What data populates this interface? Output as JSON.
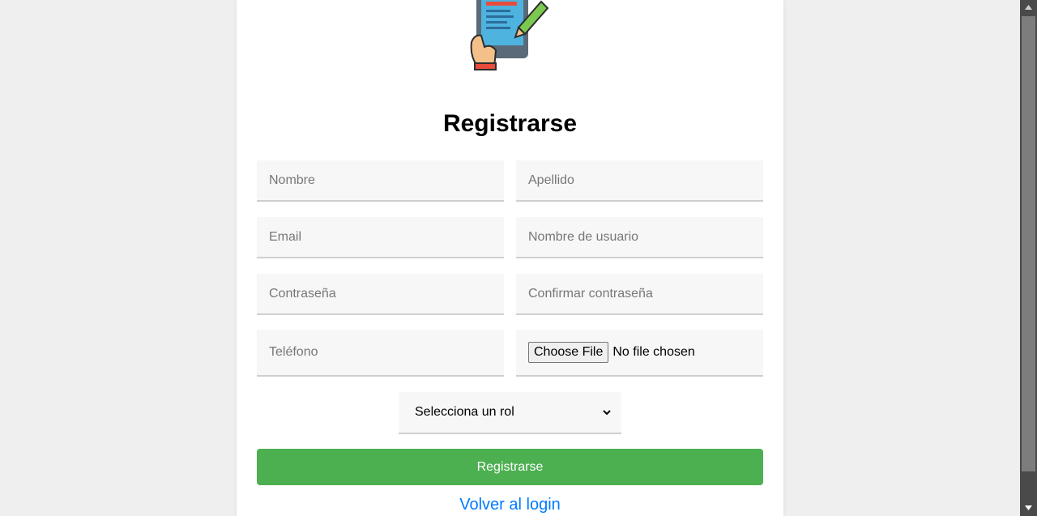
{
  "form": {
    "title": "Registrarse",
    "fields": {
      "nombre_placeholder": "Nombre",
      "apellido_placeholder": "Apellido",
      "email_placeholder": "Email",
      "username_placeholder": "Nombre de usuario",
      "password_placeholder": "Contraseña",
      "confirm_password_placeholder": "Confirmar contraseña",
      "telefono_placeholder": "Teléfono"
    },
    "file": {
      "button_label": "Choose File",
      "status": "No file chosen"
    },
    "role_select": {
      "selected": "Selecciona un rol"
    },
    "submit_label": "Registrarse",
    "back_link": "Volver al login"
  },
  "colors": {
    "submit_bg": "#4caf50",
    "link": "#007bff",
    "page_bg": "#efefef"
  },
  "icons": {
    "logo": "phone-form-icon",
    "select_chevron": "chevron-down-icon",
    "scroll_up": "arrow-up-icon",
    "scroll_down": "arrow-down-icon"
  }
}
